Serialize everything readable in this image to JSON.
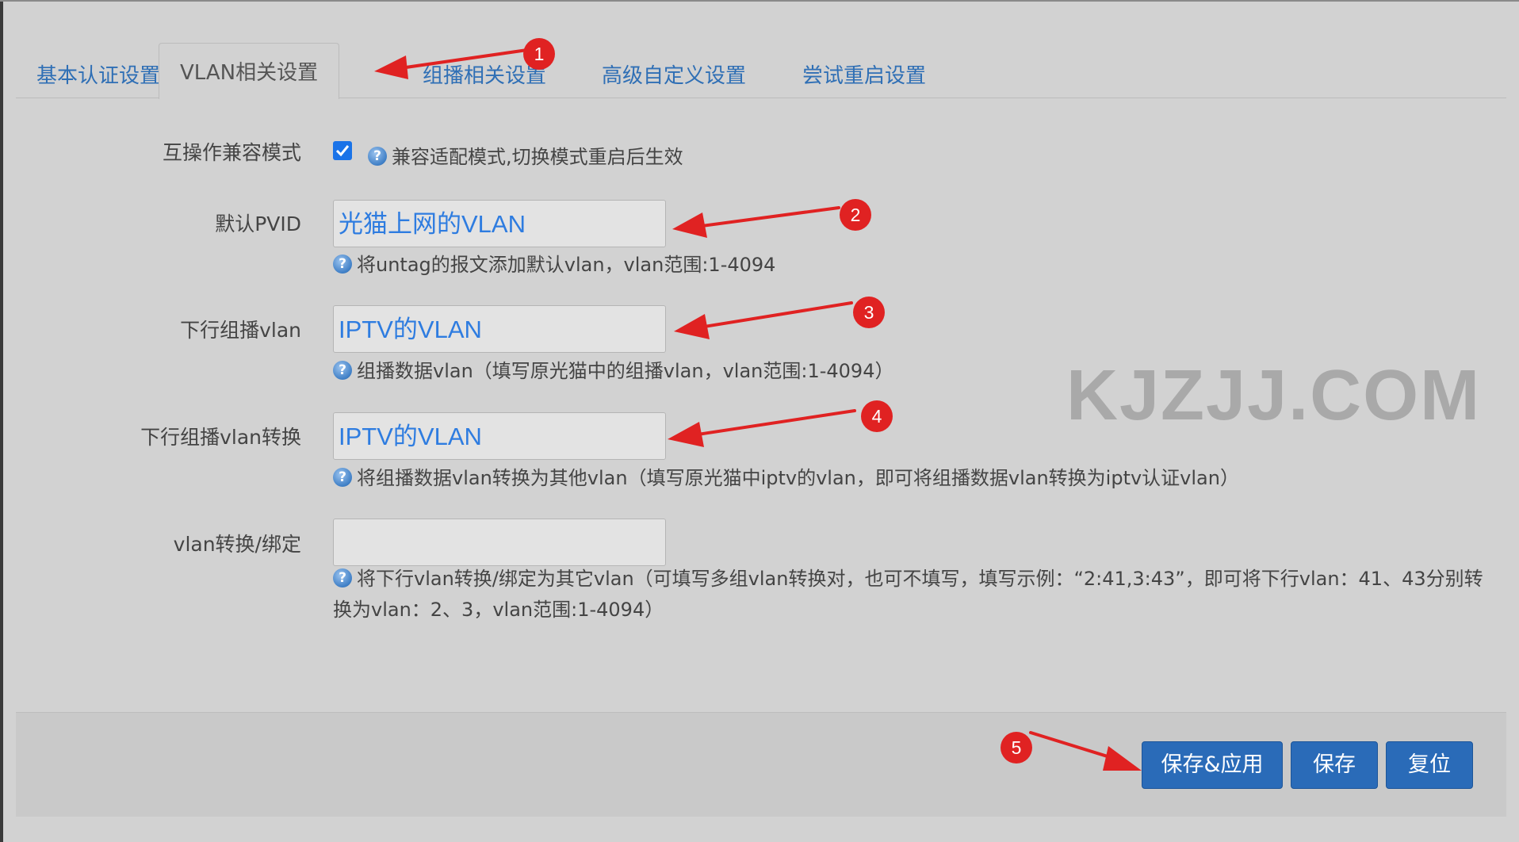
{
  "tabs": [
    {
      "label": "基本认证设置",
      "active": false
    },
    {
      "label": "VLAN相关设置",
      "active": true
    },
    {
      "label": "组播相关设置",
      "active": false
    },
    {
      "label": "高级自定义设置",
      "active": false
    },
    {
      "label": "尝试重启设置",
      "active": false
    }
  ],
  "form": {
    "interop_mode": {
      "label": "互操作兼容模式",
      "checked": true,
      "help": "兼容适配模式,切换模式重启后生效"
    },
    "default_pvid": {
      "label": "默认PVID",
      "value": "光猫上网的VLAN",
      "help": "将untag的报文添加默认vlan，vlan范围:1-4094"
    },
    "downstream_multicast_vlan": {
      "label": "下行组播vlan",
      "value": "IPTV的VLAN",
      "help": "组播数据vlan（填写原光猫中的组播vlan，vlan范围:1-4094）"
    },
    "downstream_multicast_vlan_translate": {
      "label": "下行组播vlan转换",
      "value": "IPTV的VLAN",
      "help": "将组播数据vlan转换为其他vlan（填写原光猫中iptv的vlan，即可将组播数据vlan转换为iptv认证vlan）"
    },
    "vlan_translate_bind": {
      "label": "vlan转换/绑定",
      "value": "",
      "help": "将下行vlan转换/绑定为其它vlan（可填写多组vlan转换对，也可不填写，填写示例：“2:41,3:43”，即可将下行vlan：41、43分别转换为vlan：2、3，vlan范围:1-4094）"
    }
  },
  "help_icon_glyph": "?",
  "watermark": "KJZJJ.COM",
  "actions": {
    "save_apply": "保存&应用",
    "save": "保存",
    "reset": "复位"
  },
  "markers": [
    "1",
    "2",
    "3",
    "4",
    "5"
  ],
  "colors": {
    "accent": "#2a6bb8",
    "link": "#2f6fb5",
    "input_text": "#2e7ce0",
    "annotation": "#e02222",
    "background": "#d2d2d2"
  }
}
